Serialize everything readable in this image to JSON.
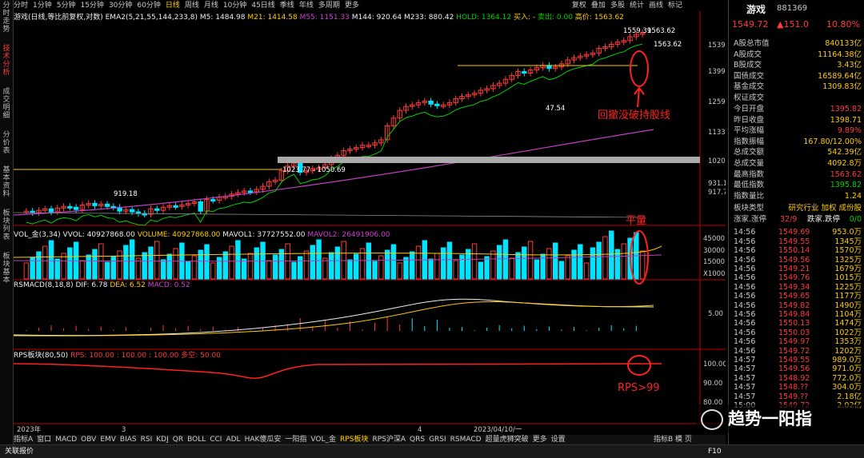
{
  "left_tabs": [
    "分时走势",
    "技术分析",
    "成交明细",
    "分价表",
    "基本资料",
    "板块列表",
    "板块基本"
  ],
  "toolbar": {
    "items": [
      "分时",
      "1分钟",
      "5分钟",
      "15分钟",
      "30分钟",
      "60分钟",
      "日线",
      "周线",
      "月线",
      "10分钟",
      "45日线",
      "季线",
      "年线",
      "多周期",
      "更多"
    ],
    "active": "日线",
    "right_items": [
      "复权",
      "叠加",
      "多股",
      "统计",
      "画线",
      "标记"
    ]
  },
  "main_info": {
    "name": "游戏(日线,等比前复权,对数)",
    "ema": "EMA2(5,21,55,144,233,8)",
    "m5": "M5: 1484.98",
    "m21": "M21: 1414.58",
    "m55": "M55: 1151.33",
    "m144": "M144: 920.64",
    "m233": "M233: 880.42",
    "hold": "HOLD: 1364.12",
    "buy": "买入: -",
    "sell": "卖出: 0.00",
    "high": "高价: 1563.62"
  },
  "price_axis": [
    "1539",
    "1399",
    "1259",
    "1133",
    "1020",
    "931.1",
    "917.7"
  ],
  "chart_data": {
    "type": "candlestick",
    "price_annotations": [
      "1559.39",
      "1563.62",
      "1563.62",
      "47.54",
      "919.18",
      "1023.77 - 1050.69"
    ],
    "annotation_text": "回撤没破持股线",
    "flat_volume_label": "平量",
    "rps_label": "RPS>99",
    "x_labels": [
      "2023年",
      "3",
      "4",
      "2023/04/10/一"
    ]
  },
  "vol_info": {
    "title": "VOL_金(3,34)",
    "vvol": "VVOL: 40927868.00",
    "volume": "VOLUME: 40927868.00",
    "mavol1": "MAVOL1: 37727552.00",
    "mavol2": "MAVOL2: 26491906.00"
  },
  "vol_axis": [
    "45000",
    "30000",
    "15000",
    "X1000"
  ],
  "macd_info": {
    "title": "RSMACD(8,18,8)",
    "dif": "DIF: 6.78",
    "dea": "DEA: 6.52",
    "macd": "MACD: 0.52"
  },
  "macd_axis": [
    "5.00"
  ],
  "rps_info": {
    "title": "RPS板块(80,50)",
    "rps": "RPS: 100.00",
    "val": ": 100.00",
    "v2": ": 100.00",
    "kong": "多空: 50.00"
  },
  "rps_axis": [
    "100.00",
    "90.00",
    "80.00"
  ],
  "bottom_tabs": [
    "指标A",
    "窗口",
    "MACD",
    "OBV",
    "EMV",
    "BIAS",
    "RSI",
    "KDJ",
    "QR",
    "BOLL",
    "CCI",
    "ADL",
    "HAK傻瓜安",
    "一阳指",
    "VOL_金",
    "RPS板块",
    "RPS沪深A",
    "QRS",
    "GRSI",
    "RSMACD",
    "超量虎狮突破",
    "更多",
    "设置"
  ],
  "bottom_active": "RPS板块",
  "bottom_right": [
    "指标B",
    "模",
    "页"
  ],
  "right_panel": {
    "name": "游戏",
    "code": "881369",
    "price": "1549.72",
    "change": "▲151.0",
    "pct": "10.80%",
    "rows": [
      [
        "A股总市值",
        "840133亿"
      ],
      [
        "A股成交",
        "11164.38亿"
      ],
      [
        "B股成交",
        "3.43亿"
      ],
      [
        "国债成交",
        "16589.64亿"
      ],
      [
        "基金成交",
        "1309.83亿"
      ],
      [
        "权证成交",
        ""
      ],
      [
        "今日开盘",
        "1395.82"
      ],
      [
        "昨日收盘",
        "1398.71"
      ],
      [
        "平均涨幅",
        "9.89%"
      ],
      [
        "指数振幅",
        "167.80/12.00%"
      ],
      [
        "总成交额",
        "542.39亿"
      ],
      [
        "总成交量",
        "4092.8万"
      ],
      [
        "最高指数",
        "1563.62"
      ],
      [
        "最低指数",
        "1395.82"
      ],
      [
        "指数量比",
        "1.24"
      ]
    ],
    "plate": {
      "label": "板块类型",
      "links": "研究行业 加权 成份股"
    },
    "updown": {
      "label1": "涨家.涨停",
      "v1": "32/9",
      "label2": "跌家.跌停",
      "v2": "0/0"
    },
    "ticks": [
      [
        "14:56",
        "1549.69",
        "953.0万"
      ],
      [
        "14:56",
        "1549.55",
        "1345万"
      ],
      [
        "14:56",
        "1550.14",
        "1570万"
      ],
      [
        "14:56",
        "1549.56",
        "1325万"
      ],
      [
        "14:56",
        "1549.21",
        "1679万"
      ],
      [
        "14:56",
        "1549.76",
        "1015万"
      ],
      [
        "14:56",
        "1549.34",
        "1225万"
      ],
      [
        "14:56",
        "1549.65",
        "1177万"
      ],
      [
        "14:56",
        "1549.82",
        "1490万"
      ],
      [
        "14:56",
        "1549.84",
        "1104万"
      ],
      [
        "14:56",
        "1550.13",
        "1474万"
      ],
      [
        "14:56",
        "1550.03",
        "1022万"
      ],
      [
        "14:56",
        "1549.97",
        "1353万"
      ],
      [
        "14:56",
        "1549.72",
        "1202万"
      ],
      [
        "14:57",
        "1549.55",
        "989.0万"
      ],
      [
        "14:57",
        "1549.56",
        "971.0万"
      ],
      [
        "14:57",
        "1548.92",
        "772.0万"
      ],
      [
        "14:57",
        "1548.??",
        "304.0万"
      ],
      [
        "14:57",
        "1549.??",
        "2.18亿"
      ],
      [
        "15:00",
        "1549.72",
        "2.02亿"
      ]
    ]
  },
  "status": {
    "left": "关联报价",
    "right": "F10"
  },
  "watermark": "趋势一阳指"
}
